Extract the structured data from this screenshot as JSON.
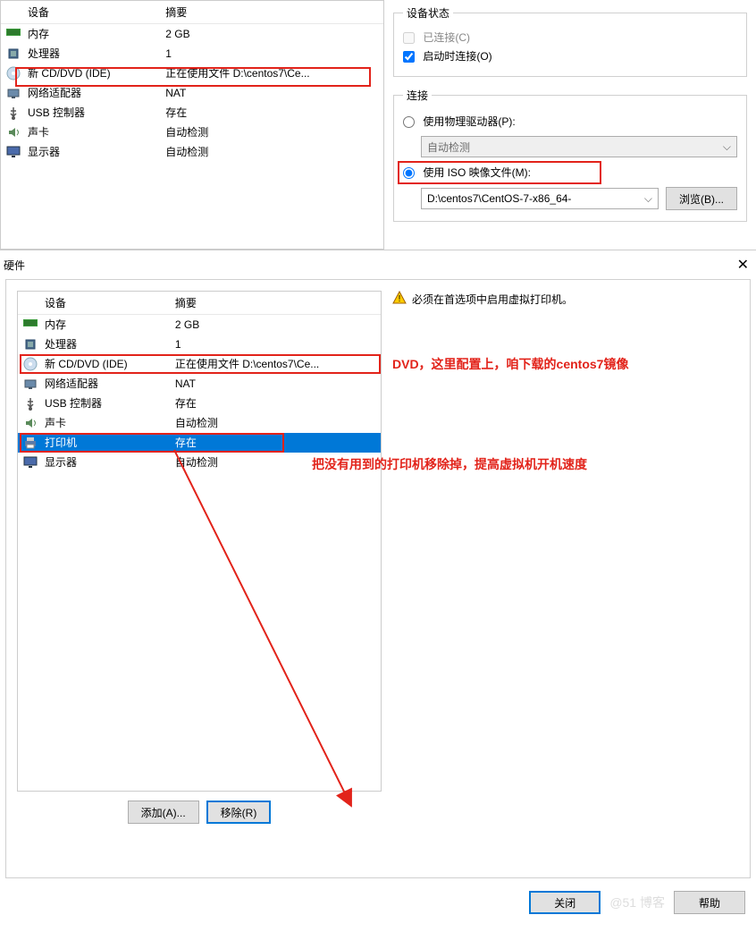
{
  "top": {
    "headers": {
      "device": "设备",
      "summary": "摘要"
    },
    "rows": [
      {
        "icon": "memory",
        "name": "内存",
        "summary": "2 GB"
      },
      {
        "icon": "cpu",
        "name": "处理器",
        "summary": "1"
      },
      {
        "icon": "disc",
        "name": "新 CD/DVD (IDE)",
        "summary": "正在使用文件 D:\\centos7\\Ce..."
      },
      {
        "icon": "net",
        "name": "网络适配器",
        "summary": "NAT"
      },
      {
        "icon": "usb",
        "name": "USB 控制器",
        "summary": "存在"
      },
      {
        "icon": "sound",
        "name": "声卡",
        "summary": "自动检测"
      },
      {
        "icon": "display",
        "name": "显示器",
        "summary": "自动检测"
      }
    ],
    "status": {
      "legend": "设备状态",
      "connected": "已连接(C)",
      "connect_on_start": "启动时连接(O)"
    },
    "connection": {
      "legend": "连接",
      "use_physical": "使用物理驱动器(P):",
      "auto_detect": "自动检测",
      "use_iso": "使用 ISO 映像文件(M):",
      "iso_path": "D:\\centos7\\CentOS-7-x86_64-",
      "browse": "浏览(B)..."
    }
  },
  "hw": {
    "title": "硬件",
    "warn": "必须在首选项中启用虚拟打印机。",
    "headers": {
      "device": "设备",
      "summary": "摘要"
    },
    "rows": [
      {
        "icon": "memory",
        "name": "内存",
        "summary": "2 GB"
      },
      {
        "icon": "cpu",
        "name": "处理器",
        "summary": "1"
      },
      {
        "icon": "disc",
        "name": "新 CD/DVD (IDE)",
        "summary": "正在使用文件 D:\\centos7\\Ce..."
      },
      {
        "icon": "net",
        "name": "网络适配器",
        "summary": "NAT"
      },
      {
        "icon": "usb",
        "name": "USB 控制器",
        "summary": "存在"
      },
      {
        "icon": "sound",
        "name": "声卡",
        "summary": "自动检测"
      },
      {
        "icon": "printer",
        "name": "打印机",
        "summary": "存在"
      },
      {
        "icon": "display",
        "name": "显示器",
        "summary": "自动检测"
      }
    ],
    "add": "添加(A)...",
    "remove": "移除(R)",
    "annot_dvd": "DVD，这里配置上，咱下载的centos7镜像",
    "annot_printer": "把没有用到的打印机移除掉，提高虚拟机开机速度"
  },
  "footer": {
    "close": "关闭",
    "help": "帮助"
  },
  "watermark": "@51 博客"
}
